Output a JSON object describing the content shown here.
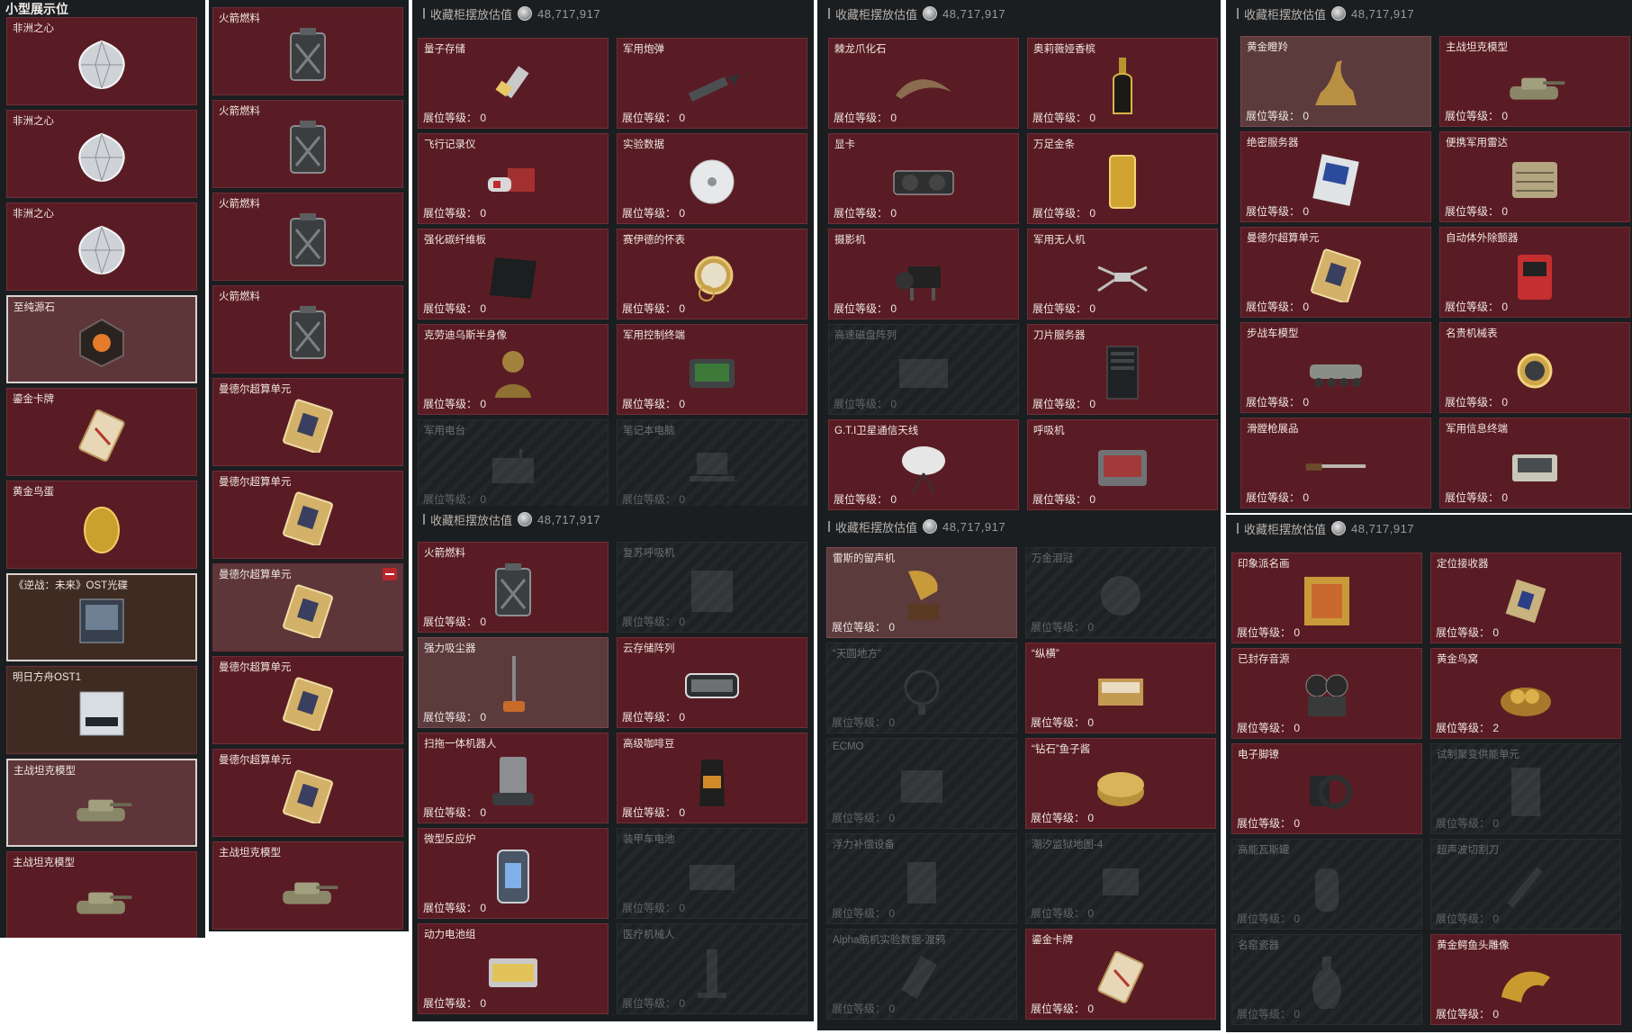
{
  "header": {
    "label": "收藏柜摆放估值",
    "value": "48,717,917"
  },
  "level_label": "展位等级：",
  "column_a": {
    "title": "小型展示位",
    "items": [
      {
        "name": "非洲之心",
        "icon": "diamond",
        "state": "normal"
      },
      {
        "name": "非洲之心",
        "icon": "diamond",
        "state": "normal"
      },
      {
        "name": "非洲之心",
        "icon": "diamond",
        "state": "normal"
      },
      {
        "name": "至纯源石",
        "icon": "crystal",
        "state": "selected"
      },
      {
        "name": "鎏金卡牌",
        "icon": "card",
        "state": "normal"
      },
      {
        "name": "黄金鸟蛋",
        "icon": "egg",
        "state": "normal"
      },
      {
        "name": "《逆战：未来》OST光碟",
        "icon": "album",
        "state": "selected-brown"
      },
      {
        "name": "明日方舟OST1",
        "icon": "album2",
        "state": "brown"
      },
      {
        "name": "主战坦克模型",
        "icon": "tank",
        "state": "selected"
      },
      {
        "name": "主战坦克模型",
        "icon": "tank",
        "state": "normal"
      }
    ]
  },
  "column_b": {
    "items": [
      {
        "name": "火箭燃料",
        "icon": "jerrycan",
        "state": "normal"
      },
      {
        "name": "火箭燃料",
        "icon": "jerrycan",
        "state": "normal"
      },
      {
        "name": "火箭燃料",
        "icon": "jerrycan",
        "state": "normal"
      },
      {
        "name": "火箭燃料",
        "icon": "jerrycan",
        "state": "normal"
      },
      {
        "name": "曼德尔超算单元",
        "icon": "chip",
        "state": "normal"
      },
      {
        "name": "曼德尔超算单元",
        "icon": "chip",
        "state": "normal"
      },
      {
        "name": "曼德尔超算单元",
        "icon": "chip",
        "state": "removable"
      },
      {
        "name": "曼德尔超算单元",
        "icon": "chip",
        "state": "normal"
      },
      {
        "name": "曼德尔超算单元",
        "icon": "chip",
        "state": "normal"
      },
      {
        "name": "主战坦克模型",
        "icon": "tank",
        "state": "normal"
      }
    ]
  },
  "panels": [
    {
      "items": [
        {
          "name": "量子存储",
          "level": "0",
          "icon": "usb",
          "state": "normal"
        },
        {
          "name": "军用炮弹",
          "level": "0",
          "icon": "shell",
          "state": "normal"
        },
        {
          "name": "飞行记录仪",
          "level": "0",
          "icon": "recorder",
          "state": "normal"
        },
        {
          "name": "实验数据",
          "level": "0",
          "icon": "disc",
          "state": "normal"
        },
        {
          "name": "强化碳纤维板",
          "level": "0",
          "icon": "plate",
          "state": "normal"
        },
        {
          "name": "赛伊德的怀表",
          "level": "0",
          "icon": "watch",
          "state": "normal"
        },
        {
          "name": "克劳迪乌斯半身像",
          "level": "0",
          "icon": "bust",
          "state": "normal"
        },
        {
          "name": "军用控制终端",
          "level": "0",
          "icon": "terminal",
          "state": "normal"
        },
        {
          "name": "军用电台",
          "level": "0",
          "icon": "radio",
          "state": "empty"
        },
        {
          "name": "笔记本电脑",
          "level": "0",
          "icon": "laptop",
          "state": "empty"
        }
      ]
    },
    {
      "items": [
        {
          "name": "棘龙爪化石",
          "level": "0",
          "icon": "claw",
          "state": "normal"
        },
        {
          "name": "奥莉薇娅香槟",
          "level": "0",
          "icon": "bottle",
          "state": "normal"
        },
        {
          "name": "显卡",
          "level": "0",
          "icon": "gpu",
          "state": "normal"
        },
        {
          "name": "万足金条",
          "level": "0",
          "icon": "goldbar",
          "state": "normal"
        },
        {
          "name": "摄影机",
          "level": "0",
          "icon": "camera",
          "state": "normal"
        },
        {
          "name": "军用无人机",
          "level": "0",
          "icon": "drone",
          "state": "normal"
        },
        {
          "name": "高速磁盘阵列",
          "level": "0",
          "icon": "disk-array",
          "state": "empty"
        },
        {
          "name": "刀片服务器",
          "level": "0",
          "icon": "server",
          "state": "normal"
        },
        {
          "name": "G.T.I卫星通信天线",
          "level": "0",
          "icon": "antenna",
          "state": "normal"
        },
        {
          "name": "呼吸机",
          "level": "0",
          "icon": "monitor",
          "state": "normal"
        }
      ]
    },
    {
      "items": [
        {
          "name": "黄金瞪羚",
          "level": "0",
          "icon": "gazelle",
          "state": "light"
        },
        {
          "name": "主战坦克模型",
          "level": "0",
          "icon": "tank",
          "state": "normal"
        },
        {
          "name": "绝密服务器",
          "level": "0",
          "icon": "server2",
          "state": "normal"
        },
        {
          "name": "便携军用雷达",
          "level": "0",
          "icon": "radar",
          "state": "normal"
        },
        {
          "name": "曼德尔超算单元",
          "level": "0",
          "icon": "chip",
          "state": "normal"
        },
        {
          "name": "自动体外除颤器",
          "level": "0",
          "icon": "defib",
          "state": "normal"
        },
        {
          "name": "步战车模型",
          "level": "0",
          "icon": "ifv",
          "state": "normal"
        },
        {
          "name": "名贵机械表",
          "level": "0",
          "icon": "wristwatch",
          "state": "normal"
        },
        {
          "name": "滑膛枪展品",
          "level": "0",
          "icon": "musket",
          "state": "normal"
        },
        {
          "name": "军用信息终端",
          "level": "0",
          "icon": "case",
          "state": "normal"
        }
      ]
    },
    {
      "items": [
        {
          "name": "火箭燃料",
          "level": "0",
          "icon": "jerrycan",
          "state": "normal"
        },
        {
          "name": "复苏呼吸机",
          "level": "0",
          "icon": "ventilator",
          "state": "empty"
        },
        {
          "name": "强力吸尘器",
          "level": "0",
          "icon": "vacuum",
          "state": "light"
        },
        {
          "name": "云存储阵列",
          "level": "0",
          "icon": "cloud-storage",
          "state": "normal"
        },
        {
          "name": "扫拖一体机器人",
          "level": "0",
          "icon": "robot",
          "state": "normal"
        },
        {
          "name": "高级咖啡豆",
          "level": "0",
          "icon": "coffee",
          "state": "normal"
        },
        {
          "name": "微型反应炉",
          "level": "0",
          "icon": "reactor",
          "state": "normal"
        },
        {
          "name": "装甲车电池",
          "level": "0",
          "icon": "battery",
          "state": "empty"
        },
        {
          "name": "动力电池组",
          "level": "0",
          "icon": "battery-pack",
          "state": "normal"
        },
        {
          "name": "医疗机械人",
          "level": "0",
          "icon": "med-robot",
          "state": "empty"
        }
      ]
    },
    {
      "items": [
        {
          "name": "雷斯的留声机",
          "level": "0",
          "icon": "gramophone",
          "state": "light"
        },
        {
          "name": "万金泪冠",
          "level": "0",
          "icon": "crown",
          "state": "empty"
        },
        {
          "name": "“天圆地方”",
          "level": "0",
          "icon": "armillary",
          "state": "empty"
        },
        {
          "name": "“纵横”",
          "level": "0",
          "icon": "chessbox",
          "state": "normal"
        },
        {
          "name": "ECMO",
          "level": "0",
          "icon": "ecmo",
          "state": "empty"
        },
        {
          "name": "“钻石”鱼子酱",
          "level": "0",
          "icon": "caviar",
          "state": "normal"
        },
        {
          "name": "浮力补偿设备",
          "level": "0",
          "icon": "bcd",
          "state": "empty"
        },
        {
          "name": "潮汐监狱地图-4",
          "level": "0",
          "icon": "map",
          "state": "empty"
        },
        {
          "name": "Alpha脑机实验数据-渡鸦",
          "level": "0",
          "icon": "data-drive",
          "state": "empty"
        },
        {
          "name": "鎏金卡牌",
          "level": "0",
          "icon": "card",
          "state": "normal"
        }
      ]
    },
    {
      "items": [
        {
          "name": "印象派名画",
          "level": "0",
          "icon": "painting",
          "state": "normal"
        },
        {
          "name": "定位接收器",
          "level": "0",
          "icon": "receiver",
          "state": "normal"
        },
        {
          "name": "已封存音源",
          "level": "0",
          "icon": "reel",
          "state": "normal"
        },
        {
          "name": "黄金鸟窝",
          "level": "2",
          "icon": "nest",
          "state": "normal"
        },
        {
          "name": "电子脚镣",
          "level": "0",
          "icon": "anklet",
          "state": "normal"
        },
        {
          "name": "试制聚变供能单元",
          "level": "0",
          "icon": "fusion",
          "state": "empty"
        },
        {
          "name": "高能瓦斯罐",
          "level": "0",
          "icon": "gas-tank",
          "state": "empty"
        },
        {
          "name": "超声波切割刀",
          "level": "0",
          "icon": "cutter",
          "state": "empty"
        },
        {
          "name": "名窑瓷器",
          "level": "0",
          "icon": "vase",
          "state": "empty"
        },
        {
          "name": "黄金鳄鱼头雕像",
          "level": "0",
          "icon": "croc",
          "state": "normal"
        }
      ]
    }
  ]
}
